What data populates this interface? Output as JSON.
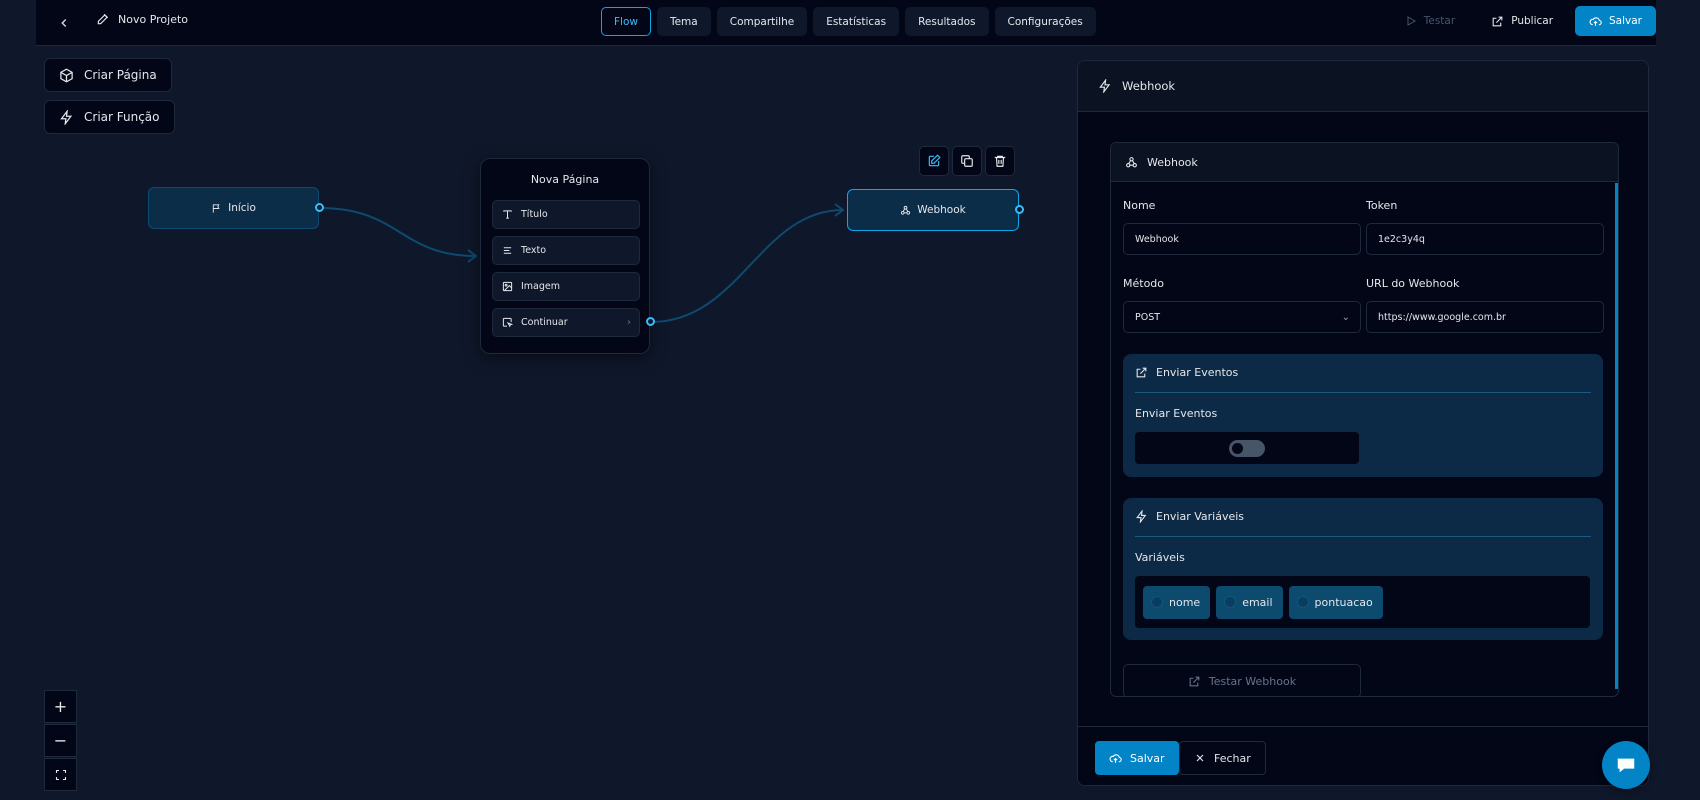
{
  "header": {
    "project_name": "Novo Projeto",
    "tabs": [
      {
        "label": "Flow",
        "active": true
      },
      {
        "label": "Tema"
      },
      {
        "label": "Compartilhe"
      },
      {
        "label": "Estatísticas"
      },
      {
        "label": "Resultados"
      },
      {
        "label": "Configurações"
      }
    ],
    "test_label": "Testar",
    "publish_label": "Publicar",
    "save_label": "Salvar"
  },
  "canvas": {
    "create_page_label": "Criar Página",
    "create_function_label": "Criar Função",
    "start_node_label": "Início",
    "page_node": {
      "title": "Nova Página",
      "items": [
        "Título",
        "Texto",
        "Imagem",
        "Continuar"
      ]
    },
    "webhook_node_label": "Webhook",
    "zoom_in": "+",
    "zoom_out": "−"
  },
  "panel": {
    "title": "Webhook",
    "card_title": "Webhook",
    "name_label": "Nome",
    "name_value": "Webhook",
    "token_label": "Token",
    "token_value": "1e2c3y4q",
    "method_label": "Método",
    "method_value": "POST",
    "url_label": "URL do Webhook",
    "url_value": "https://www.google.com.br",
    "events_section_title": "Enviar Eventos",
    "events_label": "Enviar Eventos",
    "events_enabled": false,
    "vars_section_title": "Enviar Variáveis",
    "vars_label": "Variáveis",
    "variables": [
      "nome",
      "email",
      "pontuacao"
    ],
    "test_webhook_label": "Testar Webhook",
    "save_label": "Salvar",
    "close_label": "Fechar"
  },
  "colors": {
    "accent": "#0284c7",
    "background": "#0f172a",
    "node_fill": "#0c2d48"
  }
}
